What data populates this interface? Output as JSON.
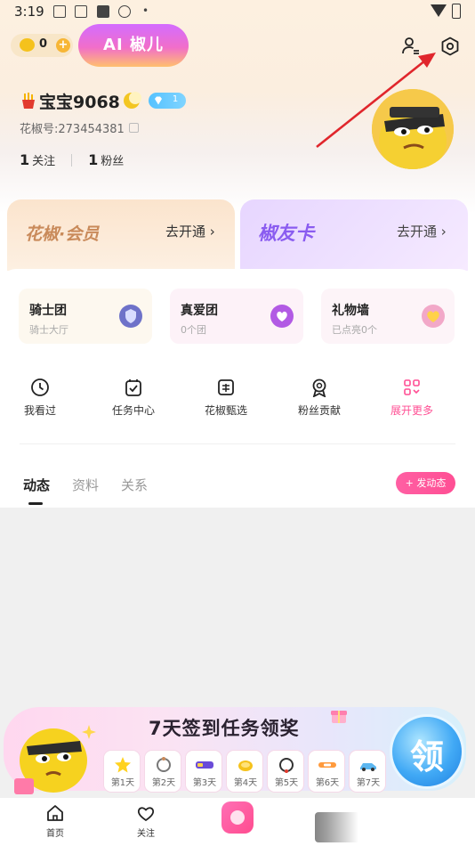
{
  "status_bar": {
    "time": "3:19"
  },
  "header": {
    "coin_count": "0",
    "coin_plus": "+",
    "ai_button_label": "AI 椒儿"
  },
  "profile": {
    "username": "宝宝9068",
    "level": "1",
    "user_id": "花椒号:273454381",
    "following_count": "1",
    "following_label": "关注",
    "fans_count": "1",
    "fans_label": "粉丝"
  },
  "membership": {
    "vip_title": "花椒·会员",
    "vip_cta": "去开通 ›",
    "friend_card_title": "椒友卡",
    "friend_card_cta": "去开通 ›"
  },
  "fan_cards": [
    {
      "title": "骑士团",
      "subtitle": "骑士大厅"
    },
    {
      "title": "真爱团",
      "subtitle": "0个团"
    },
    {
      "title": "礼物墙",
      "subtitle": "已点亮0个"
    }
  ],
  "tools": [
    {
      "label": "我看过",
      "icon": "clock-icon"
    },
    {
      "label": "任务中心",
      "icon": "task-icon"
    },
    {
      "label": "花椒甄选",
      "icon": "shop-icon"
    },
    {
      "label": "粉丝贡献",
      "icon": "medal-icon"
    },
    {
      "label": "展开更多",
      "icon": "grid-icon"
    }
  ],
  "tabs": [
    {
      "label": "动态",
      "active": true
    },
    {
      "label": "资料",
      "active": false
    },
    {
      "label": "关系",
      "active": false
    }
  ],
  "post_button_label": "+ 发动态",
  "checkin": {
    "title": "7天签到任务领奖",
    "claim_label": "领",
    "days": [
      "第1天",
      "第2天",
      "第3天",
      "第4天",
      "第5天",
      "第6天",
      "第7天"
    ]
  },
  "bottom_nav": [
    {
      "label": "首页",
      "icon": "home-icon"
    },
    {
      "label": "关注",
      "icon": "heart-icon"
    }
  ],
  "colors": {
    "accent_pink": "#ff4f94",
    "ai_button_purple": "#d36cff",
    "friend_card_purple": "#8a5cf0",
    "vip_gold": "#c98a5a",
    "annotation_red": "#e0262c"
  }
}
